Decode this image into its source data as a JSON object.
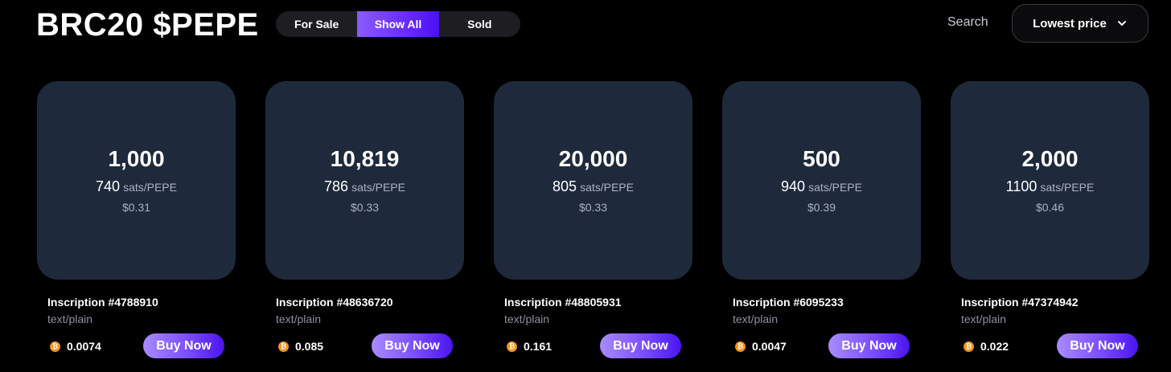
{
  "header": {
    "title": "BRC20 $PEPE",
    "filters": [
      "For Sale",
      "Show All",
      "Sold"
    ],
    "active_filter": "Show All",
    "search_label": "Search",
    "sort_label": "Lowest price"
  },
  "listings": [
    {
      "amount": "1,000",
      "rate": "740",
      "unit": "sats/PEPE",
      "usd": "$0.31",
      "inscription": "Inscription #4788910",
      "mime": "text/plain",
      "btc_price": "0.0074",
      "buy_label": "Buy Now"
    },
    {
      "amount": "10,819",
      "rate": "786",
      "unit": "sats/PEPE",
      "usd": "$0.33",
      "inscription": "Inscription #48636720",
      "mime": "text/plain",
      "btc_price": "0.085",
      "buy_label": "Buy Now"
    },
    {
      "amount": "20,000",
      "rate": "805",
      "unit": "sats/PEPE",
      "usd": "$0.33",
      "inscription": "Inscription #48805931",
      "mime": "text/plain",
      "btc_price": "0.161",
      "buy_label": "Buy Now"
    },
    {
      "amount": "500",
      "rate": "940",
      "unit": "sats/PEPE",
      "usd": "$0.39",
      "inscription": "Inscription #6095233",
      "mime": "text/plain",
      "btc_price": "0.0047",
      "buy_label": "Buy Now"
    },
    {
      "amount": "2,000",
      "rate": "1100",
      "unit": "sats/PEPE",
      "usd": "$0.46",
      "inscription": "Inscription #47374942",
      "mime": "text/plain",
      "btc_price": "0.022",
      "buy_label": "Buy Now"
    }
  ],
  "icons": {
    "currency": "bitcoin-icon",
    "sort_chevron": "chevron-down-icon"
  },
  "colors": {
    "accent": "#6a2bff",
    "card_bg": "#1e293b",
    "bitcoin": "#f7931a"
  }
}
